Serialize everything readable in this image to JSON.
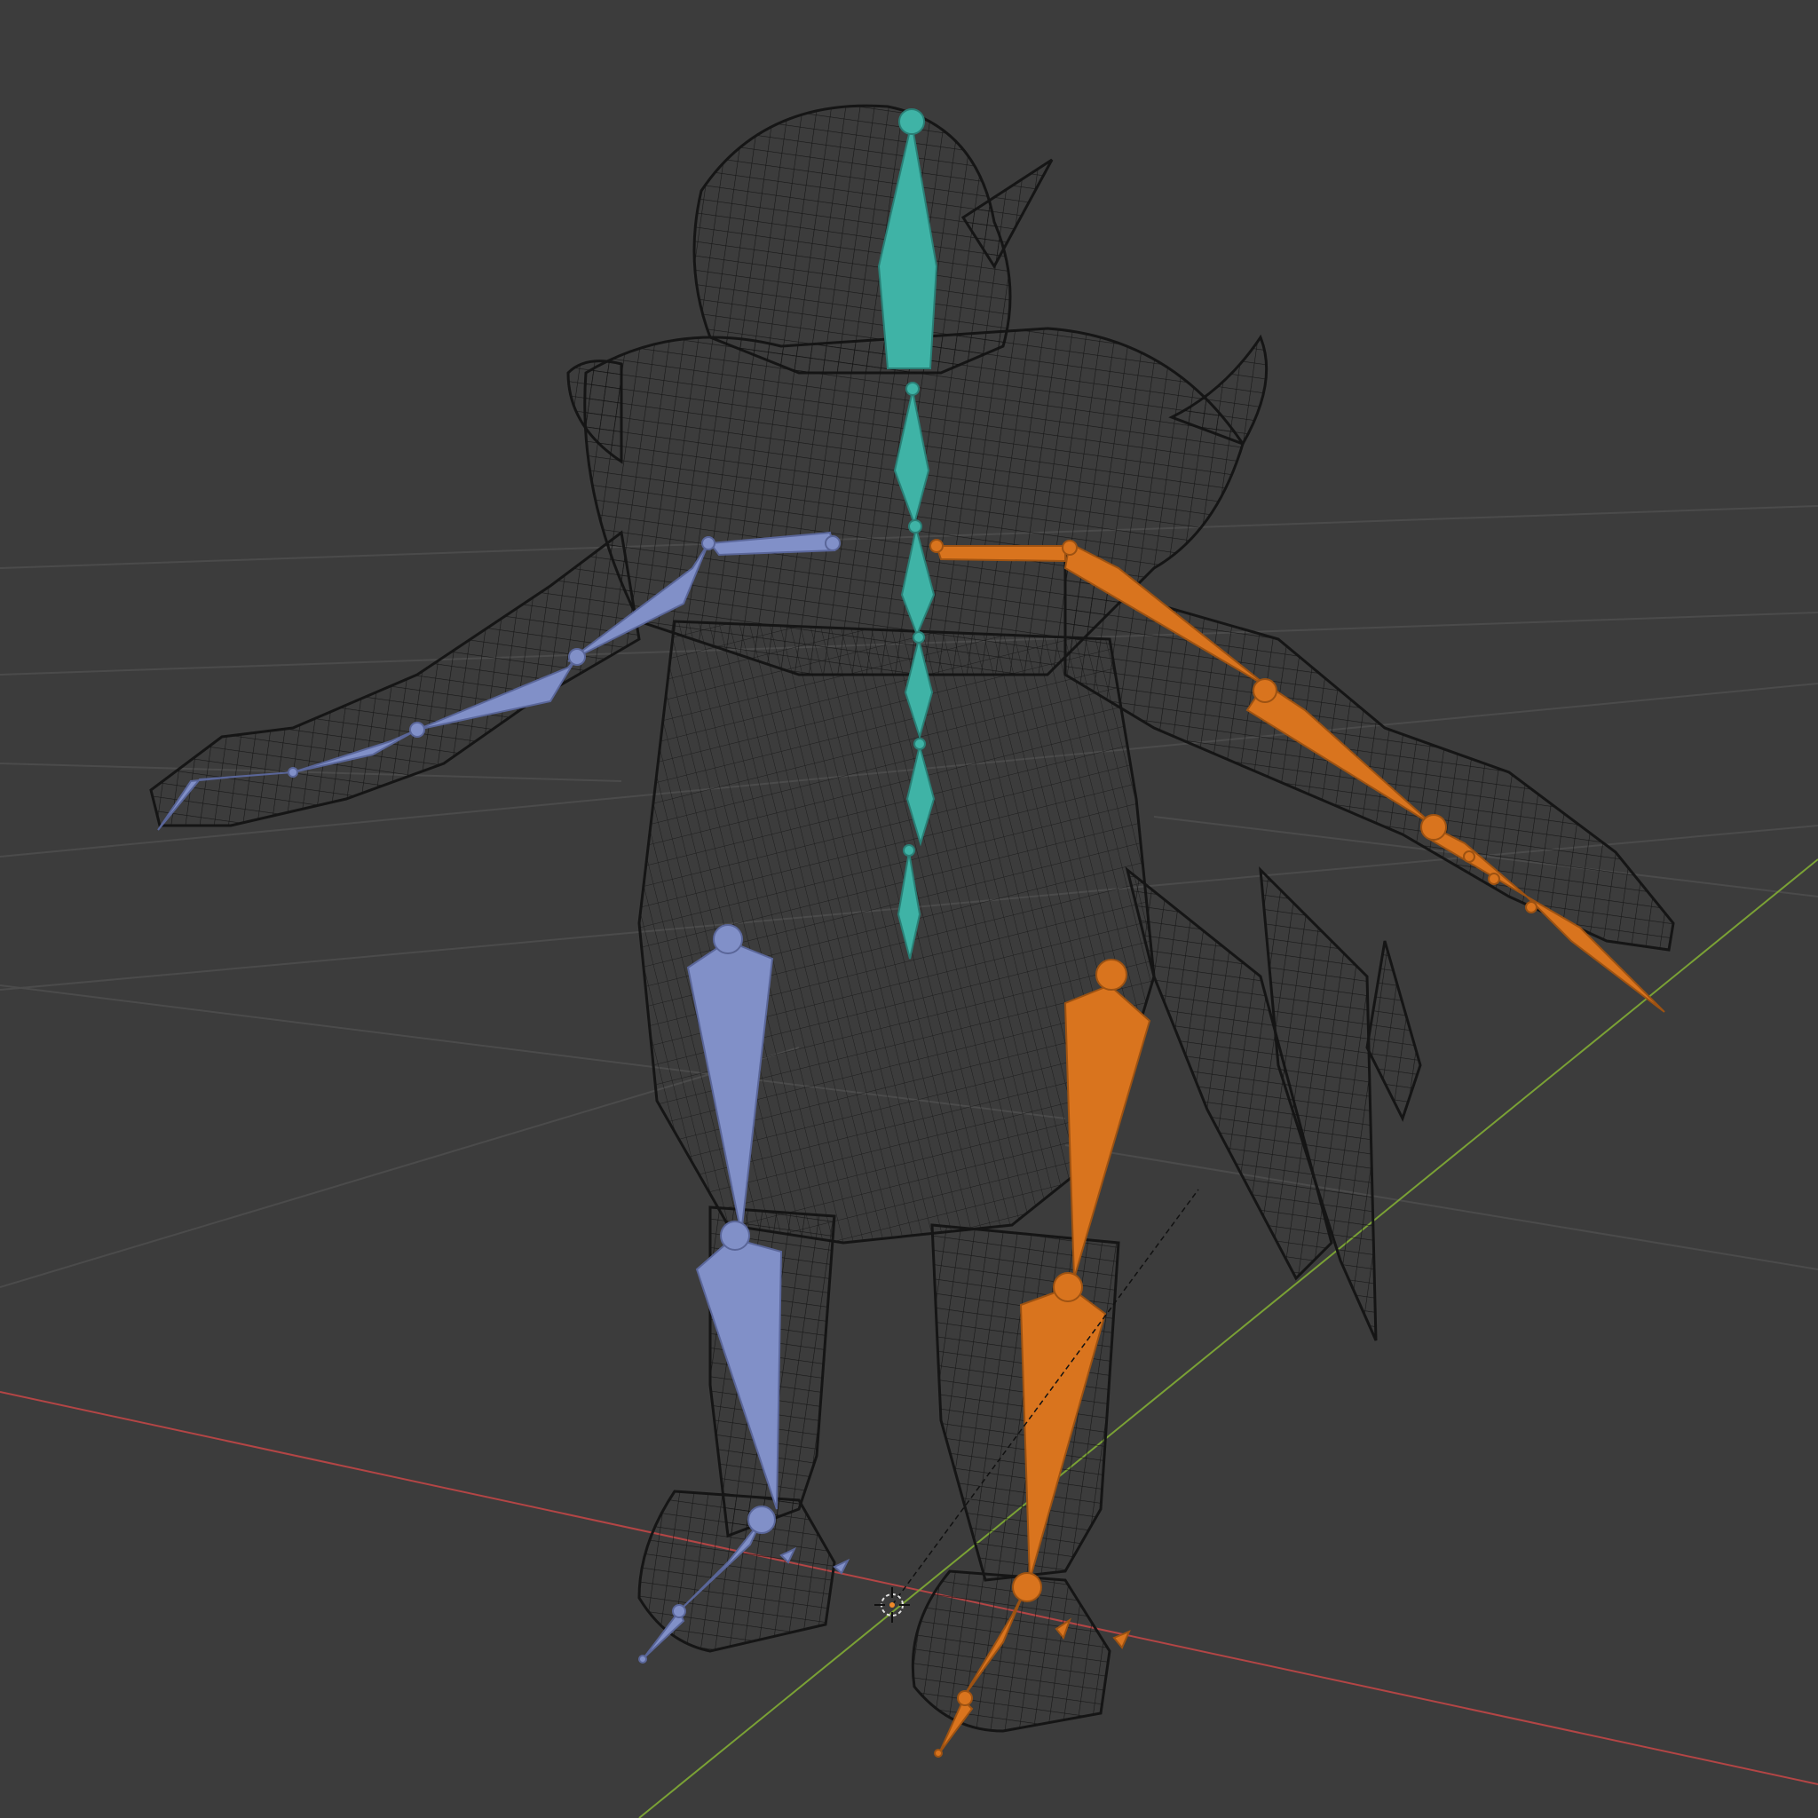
{
  "viewport": {
    "background": "#3c3c3c",
    "grid_color": "#4a4a4a",
    "axis_x_color": "#c34a4a",
    "axis_y_color": "#7ba23a",
    "wireframe_color": "#141414"
  },
  "armature": {
    "center_color": "#3fb3a6",
    "left_color": "#8190c8",
    "right_color": "#d9741e"
  },
  "origin_icon": "3d-cursor-icon"
}
